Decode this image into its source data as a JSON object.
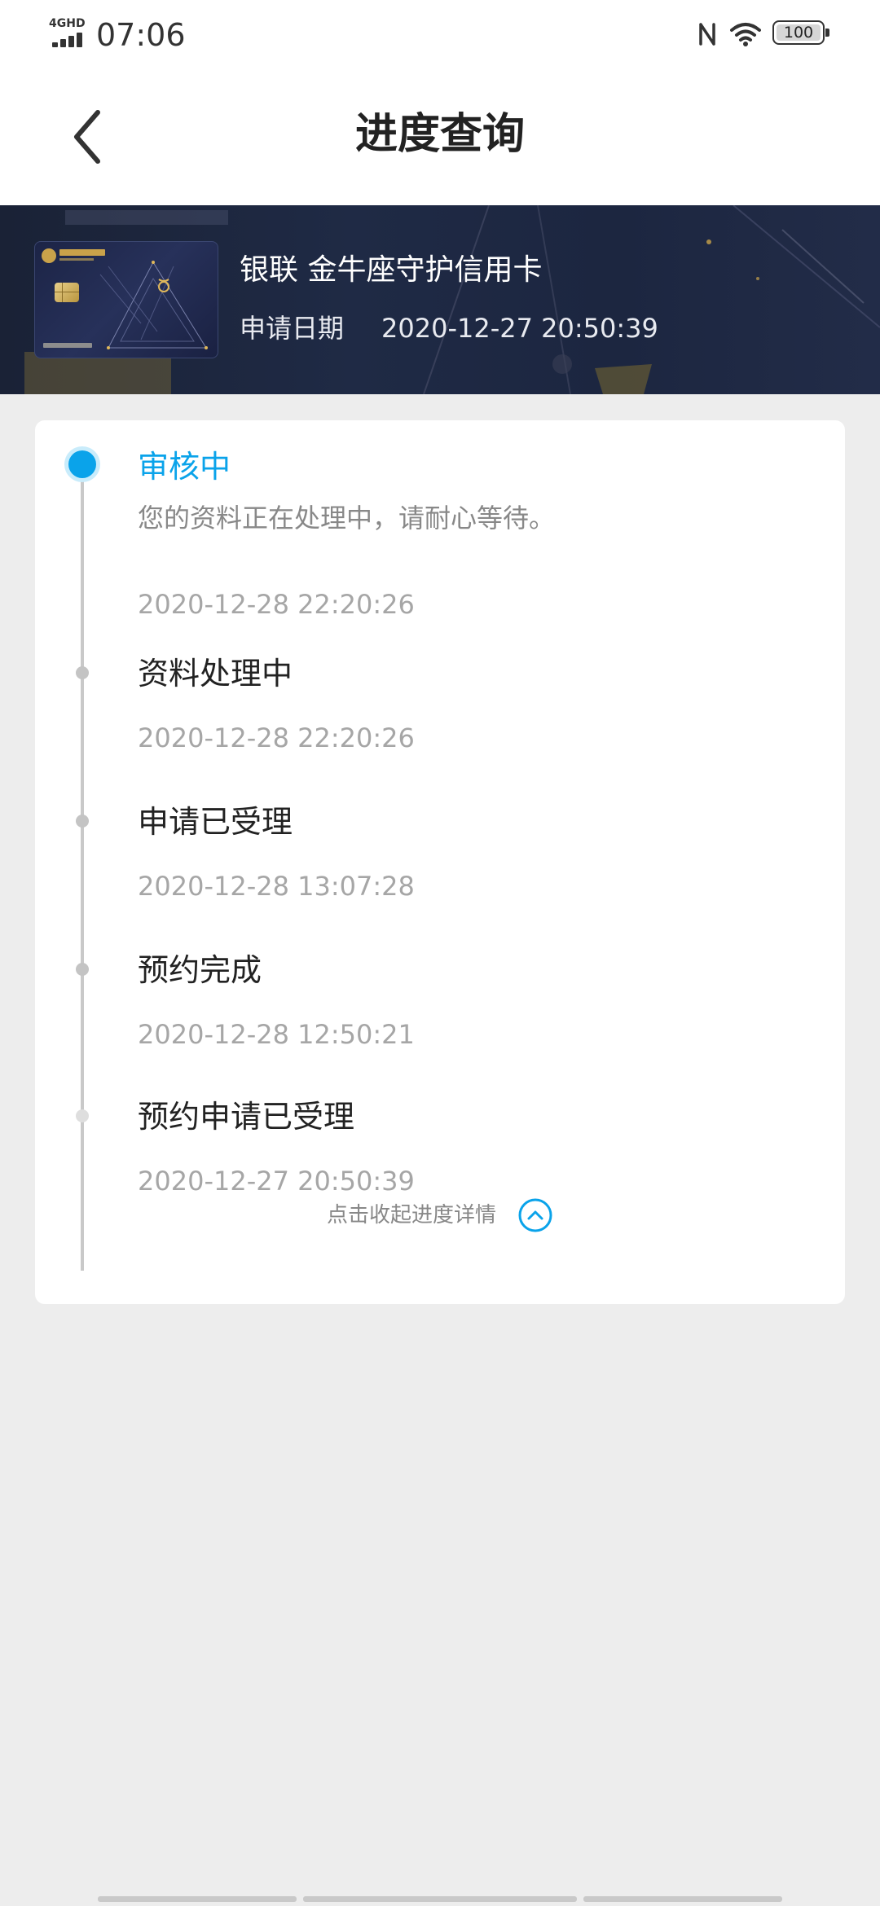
{
  "status_bar": {
    "network": "4GHD",
    "time": "07:06",
    "battery": "100"
  },
  "nav": {
    "title": "进度查询"
  },
  "card": {
    "name": "银联 金牛座守护信用卡",
    "apply_date_label": "申请日期",
    "apply_date_value": "2020-12-27 20:50:39",
    "colors": {
      "banner": "#1f2a45",
      "accent_gold": "#c9a24a"
    }
  },
  "progress": {
    "current": {
      "title": "审核中",
      "description": "您的资料正在处理中，请耐心等待。",
      "time": "2020-12-28 22:20:26",
      "color": "#0aa3ea"
    },
    "steps": [
      {
        "title": "资料处理中",
        "time": "2020-12-28 22:20:26"
      },
      {
        "title": "申请已受理",
        "time": "2020-12-28 13:07:28"
      },
      {
        "title": "预约完成",
        "time": "2020-12-28 12:50:21"
      },
      {
        "title": "预约申请已受理",
        "time": "2020-12-27 20:50:39"
      }
    ],
    "collapse_label": "点击收起进度详情"
  }
}
